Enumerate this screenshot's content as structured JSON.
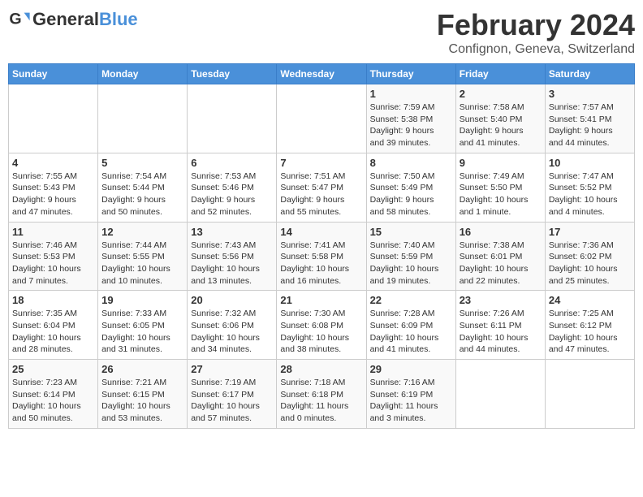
{
  "header": {
    "logo_line1": "General",
    "logo_line2": "Blue",
    "main_title": "February 2024",
    "subtitle": "Confignon, Geneva, Switzerland"
  },
  "days_of_week": [
    "Sunday",
    "Monday",
    "Tuesday",
    "Wednesday",
    "Thursday",
    "Friday",
    "Saturday"
  ],
  "weeks": [
    [
      {
        "day": "",
        "info": ""
      },
      {
        "day": "",
        "info": ""
      },
      {
        "day": "",
        "info": ""
      },
      {
        "day": "",
        "info": ""
      },
      {
        "day": "1",
        "info": "Sunrise: 7:59 AM\nSunset: 5:38 PM\nDaylight: 9 hours\nand 39 minutes."
      },
      {
        "day": "2",
        "info": "Sunrise: 7:58 AM\nSunset: 5:40 PM\nDaylight: 9 hours\nand 41 minutes."
      },
      {
        "day": "3",
        "info": "Sunrise: 7:57 AM\nSunset: 5:41 PM\nDaylight: 9 hours\nand 44 minutes."
      }
    ],
    [
      {
        "day": "4",
        "info": "Sunrise: 7:55 AM\nSunset: 5:43 PM\nDaylight: 9 hours\nand 47 minutes."
      },
      {
        "day": "5",
        "info": "Sunrise: 7:54 AM\nSunset: 5:44 PM\nDaylight: 9 hours\nand 50 minutes."
      },
      {
        "day": "6",
        "info": "Sunrise: 7:53 AM\nSunset: 5:46 PM\nDaylight: 9 hours\nand 52 minutes."
      },
      {
        "day": "7",
        "info": "Sunrise: 7:51 AM\nSunset: 5:47 PM\nDaylight: 9 hours\nand 55 minutes."
      },
      {
        "day": "8",
        "info": "Sunrise: 7:50 AM\nSunset: 5:49 PM\nDaylight: 9 hours\nand 58 minutes."
      },
      {
        "day": "9",
        "info": "Sunrise: 7:49 AM\nSunset: 5:50 PM\nDaylight: 10 hours\nand 1 minute."
      },
      {
        "day": "10",
        "info": "Sunrise: 7:47 AM\nSunset: 5:52 PM\nDaylight: 10 hours\nand 4 minutes."
      }
    ],
    [
      {
        "day": "11",
        "info": "Sunrise: 7:46 AM\nSunset: 5:53 PM\nDaylight: 10 hours\nand 7 minutes."
      },
      {
        "day": "12",
        "info": "Sunrise: 7:44 AM\nSunset: 5:55 PM\nDaylight: 10 hours\nand 10 minutes."
      },
      {
        "day": "13",
        "info": "Sunrise: 7:43 AM\nSunset: 5:56 PM\nDaylight: 10 hours\nand 13 minutes."
      },
      {
        "day": "14",
        "info": "Sunrise: 7:41 AM\nSunset: 5:58 PM\nDaylight: 10 hours\nand 16 minutes."
      },
      {
        "day": "15",
        "info": "Sunrise: 7:40 AM\nSunset: 5:59 PM\nDaylight: 10 hours\nand 19 minutes."
      },
      {
        "day": "16",
        "info": "Sunrise: 7:38 AM\nSunset: 6:01 PM\nDaylight: 10 hours\nand 22 minutes."
      },
      {
        "day": "17",
        "info": "Sunrise: 7:36 AM\nSunset: 6:02 PM\nDaylight: 10 hours\nand 25 minutes."
      }
    ],
    [
      {
        "day": "18",
        "info": "Sunrise: 7:35 AM\nSunset: 6:04 PM\nDaylight: 10 hours\nand 28 minutes."
      },
      {
        "day": "19",
        "info": "Sunrise: 7:33 AM\nSunset: 6:05 PM\nDaylight: 10 hours\nand 31 minutes."
      },
      {
        "day": "20",
        "info": "Sunrise: 7:32 AM\nSunset: 6:06 PM\nDaylight: 10 hours\nand 34 minutes."
      },
      {
        "day": "21",
        "info": "Sunrise: 7:30 AM\nSunset: 6:08 PM\nDaylight: 10 hours\nand 38 minutes."
      },
      {
        "day": "22",
        "info": "Sunrise: 7:28 AM\nSunset: 6:09 PM\nDaylight: 10 hours\nand 41 minutes."
      },
      {
        "day": "23",
        "info": "Sunrise: 7:26 AM\nSunset: 6:11 PM\nDaylight: 10 hours\nand 44 minutes."
      },
      {
        "day": "24",
        "info": "Sunrise: 7:25 AM\nSunset: 6:12 PM\nDaylight: 10 hours\nand 47 minutes."
      }
    ],
    [
      {
        "day": "25",
        "info": "Sunrise: 7:23 AM\nSunset: 6:14 PM\nDaylight: 10 hours\nand 50 minutes."
      },
      {
        "day": "26",
        "info": "Sunrise: 7:21 AM\nSunset: 6:15 PM\nDaylight: 10 hours\nand 53 minutes."
      },
      {
        "day": "27",
        "info": "Sunrise: 7:19 AM\nSunset: 6:17 PM\nDaylight: 10 hours\nand 57 minutes."
      },
      {
        "day": "28",
        "info": "Sunrise: 7:18 AM\nSunset: 6:18 PM\nDaylight: 11 hours\nand 0 minutes."
      },
      {
        "day": "29",
        "info": "Sunrise: 7:16 AM\nSunset: 6:19 PM\nDaylight: 11 hours\nand 3 minutes."
      },
      {
        "day": "",
        "info": ""
      },
      {
        "day": "",
        "info": ""
      }
    ]
  ]
}
